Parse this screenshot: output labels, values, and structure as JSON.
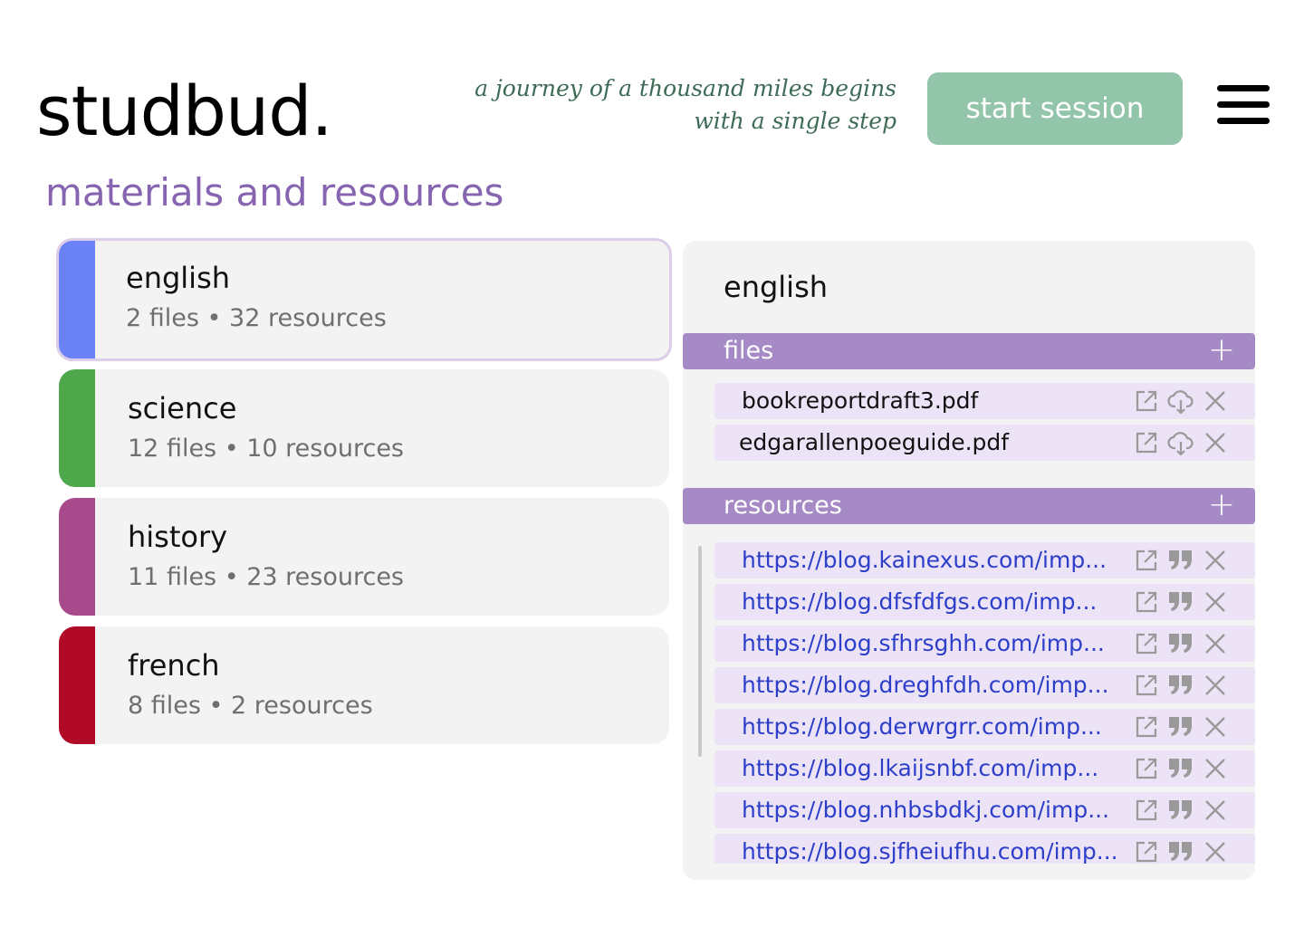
{
  "app": {
    "logo": "studbud.",
    "quote_line1": "a journey of a thousand miles begins",
    "quote_line2": "with a single step",
    "start_label": "start session"
  },
  "page": {
    "title": "materials and resources"
  },
  "subjects": [
    {
      "name": "english",
      "meta": "2 files • 32 resources",
      "color": "#6b82f6"
    },
    {
      "name": "science",
      "meta": "12 files • 10 resources",
      "color": "#4ea74a"
    },
    {
      "name": "history",
      "meta": "11 files • 23 resources",
      "color": "#a8498c"
    },
    {
      "name": "french",
      "meta": "8 files • 2 resources",
      "color": "#b00a27"
    }
  ],
  "detail": {
    "title": "english",
    "files_label": "files",
    "resources_label": "resources",
    "add_symbol": "+",
    "files": [
      "bookreportdraft3.pdf",
      "edgarallenpoeguide.pdf"
    ],
    "resources": [
      "https://blog.kainexus.com/imp...",
      "https://blog.dfsfdfgs.com/imp...",
      "https://blog.sfhrsghh.com/imp...",
      "https://blog.dreghfdh.com/imp...",
      "https://blog.derwrgrr.com/imp...",
      "https://blog.lkaijsnbf.com/imp...",
      "https://blog.nhbsbdkj.com/imp...",
      "https://blog.sjfheiufhu.com/imp..."
    ]
  },
  "icons": {
    "open": "open-external-icon",
    "download": "cloud-download-icon",
    "quote": "quote-icon",
    "delete": "close-icon"
  }
}
